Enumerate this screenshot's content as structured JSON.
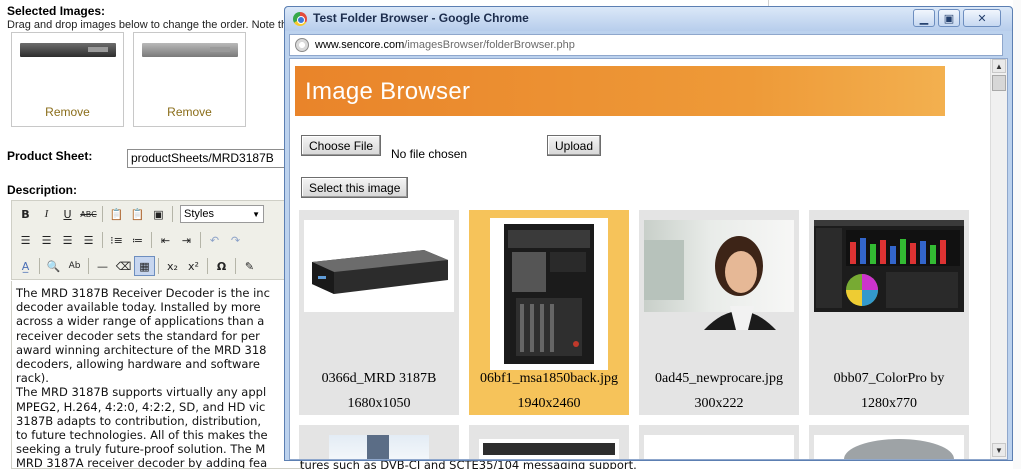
{
  "cms": {
    "selected_images_label": "Selected Images:",
    "drag_note": "Drag and drop images below to change the order. Note th",
    "remove_label": "Remove",
    "product_sheet_label": "Product Sheet:",
    "product_sheet_value": "productSheets/MRD3187B",
    "description_label": "Description:",
    "styles_placeholder": "Styles",
    "editor_lines": [
      "The MRD 3187B Receiver Decoder is the inc",
      "decoder available today. Installed by more",
      "across a wider range of applications than a",
      "receiver decoder sets the standard for per",
      "award winning architecture of the MRD 318",
      "decoders, allowing hardware and software",
      "rack).",
      "The MRD 3187B supports virtually any appl",
      "MPEG2, H.264, 4:2:0, 4:2:2, SD, and HD vic",
      "3187B adapts to contribution, distribution,",
      "to future technologies. All of this makes the",
      "seeking a truly future-proof solution. The M",
      "MRD 3187A receiver decoder by adding fea"
    ],
    "bottom_text": "tures such as DVB-CI and SCTE35/104 messaging support."
  },
  "window": {
    "title": "Test Folder Browser - Google Chrome",
    "url_domain": "www.sencore.com",
    "url_path": "/imagesBrowser/folderBrowser.php",
    "banner_title": "Image Browser",
    "choose_file_label": "Choose File",
    "no_file_text": "No file chosen",
    "upload_label": "Upload",
    "select_image_label": "Select this image",
    "images": [
      {
        "name": "0366d_MRD 3187B",
        "dims": "1680x1050",
        "selected": false
      },
      {
        "name": "06bf1_msa1850back.jpg",
        "dims": "1940x2460",
        "selected": true
      },
      {
        "name": "0ad45_newprocare.jpg",
        "dims": "300x222",
        "selected": false
      },
      {
        "name": "0bb07_ColorPro by",
        "dims": "1280x770",
        "selected": false
      }
    ]
  },
  "colors": {
    "banner": "#ee9a38",
    "selected_tile": "#f6c35a",
    "tile": "#e4e4e4"
  }
}
